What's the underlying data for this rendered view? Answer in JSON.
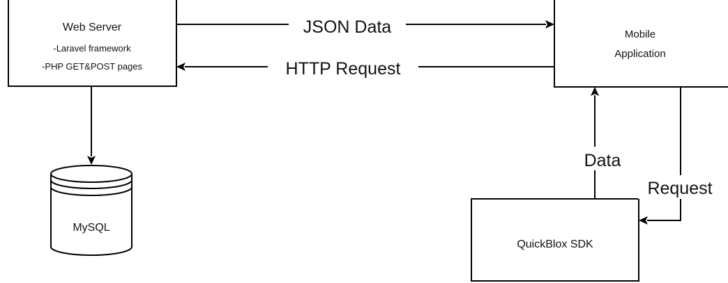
{
  "diagram": {
    "nodes": {
      "web_server": {
        "title": "Web Server",
        "line1": "-Laravel framework",
        "line2": "-PHP GET&POST pages"
      },
      "mobile_app": {
        "line1": "Mobile",
        "line2": "Application"
      },
      "mysql": {
        "label": "MySQL"
      },
      "quickblox": {
        "label": "QuickBlox SDK"
      }
    },
    "edges": {
      "json_data": "JSON Data",
      "http_request": "HTTP Request",
      "data": "Data",
      "request": "Request"
    }
  }
}
